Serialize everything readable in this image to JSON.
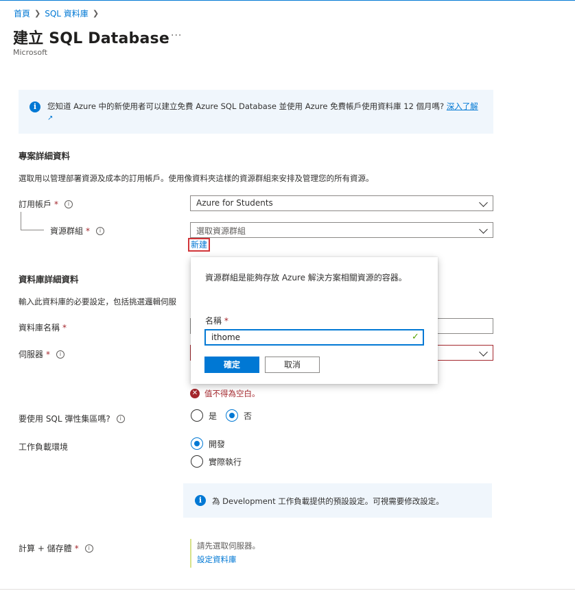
{
  "breadcrumb": {
    "home": "首頁",
    "sql_databases": "SQL 資料庫"
  },
  "header": {
    "title": "建立 SQL Database",
    "more": "···",
    "publisher": "Microsoft"
  },
  "info_banner": {
    "text": "您知道 Azure 中的新使用者可以建立免費 Azure SQL Database 並使用 Azure 免費帳戶使用資料庫 12 個月嗎? ",
    "link": "深入了解"
  },
  "project": {
    "title": "專案詳細資料",
    "desc": "選取用以管理部署資源及成本的訂用帳戶。使用像資料夾這樣的資源群組來安排及管理您的所有資源。",
    "subscription_label": "訂用帳戶",
    "subscription_value": "Azure for Students",
    "rg_label": "資源群組",
    "rg_placeholder": "選取資源群組",
    "new_link": "新建"
  },
  "database": {
    "title": "資料庫詳細資料",
    "desc": "輸入此資料庫的必要設定，包括挑選邏輯伺服",
    "name_label": "資料庫名稱",
    "server_label": "伺服器",
    "server_error": "值不得為空白。",
    "elastic_label": "要使用 SQL 彈性集區嗎?",
    "elastic_yes": "是",
    "elastic_no": "否",
    "workload_label": "工作負載環境",
    "workload_dev": "開發",
    "workload_prod": "實際執行",
    "workload_info": "為 Development 工作負載提供的預設設定。可視需要修改設定。",
    "compute_label": "計算 + 儲存體",
    "compute_hint": "請先選取伺服器。",
    "compute_link": "設定資料庫"
  },
  "callout": {
    "text": "資源群組是能夠存放 Azure 解決方案相關資源的容器。",
    "name_label": "名稱",
    "name_value": "ithome",
    "ok": "確定",
    "cancel": "取消"
  },
  "required_mark": "*",
  "colors": {
    "accent": "#0078d4",
    "error": "#a4262c",
    "banner_bg": "#f0f6fc",
    "valid": "#57a300"
  }
}
